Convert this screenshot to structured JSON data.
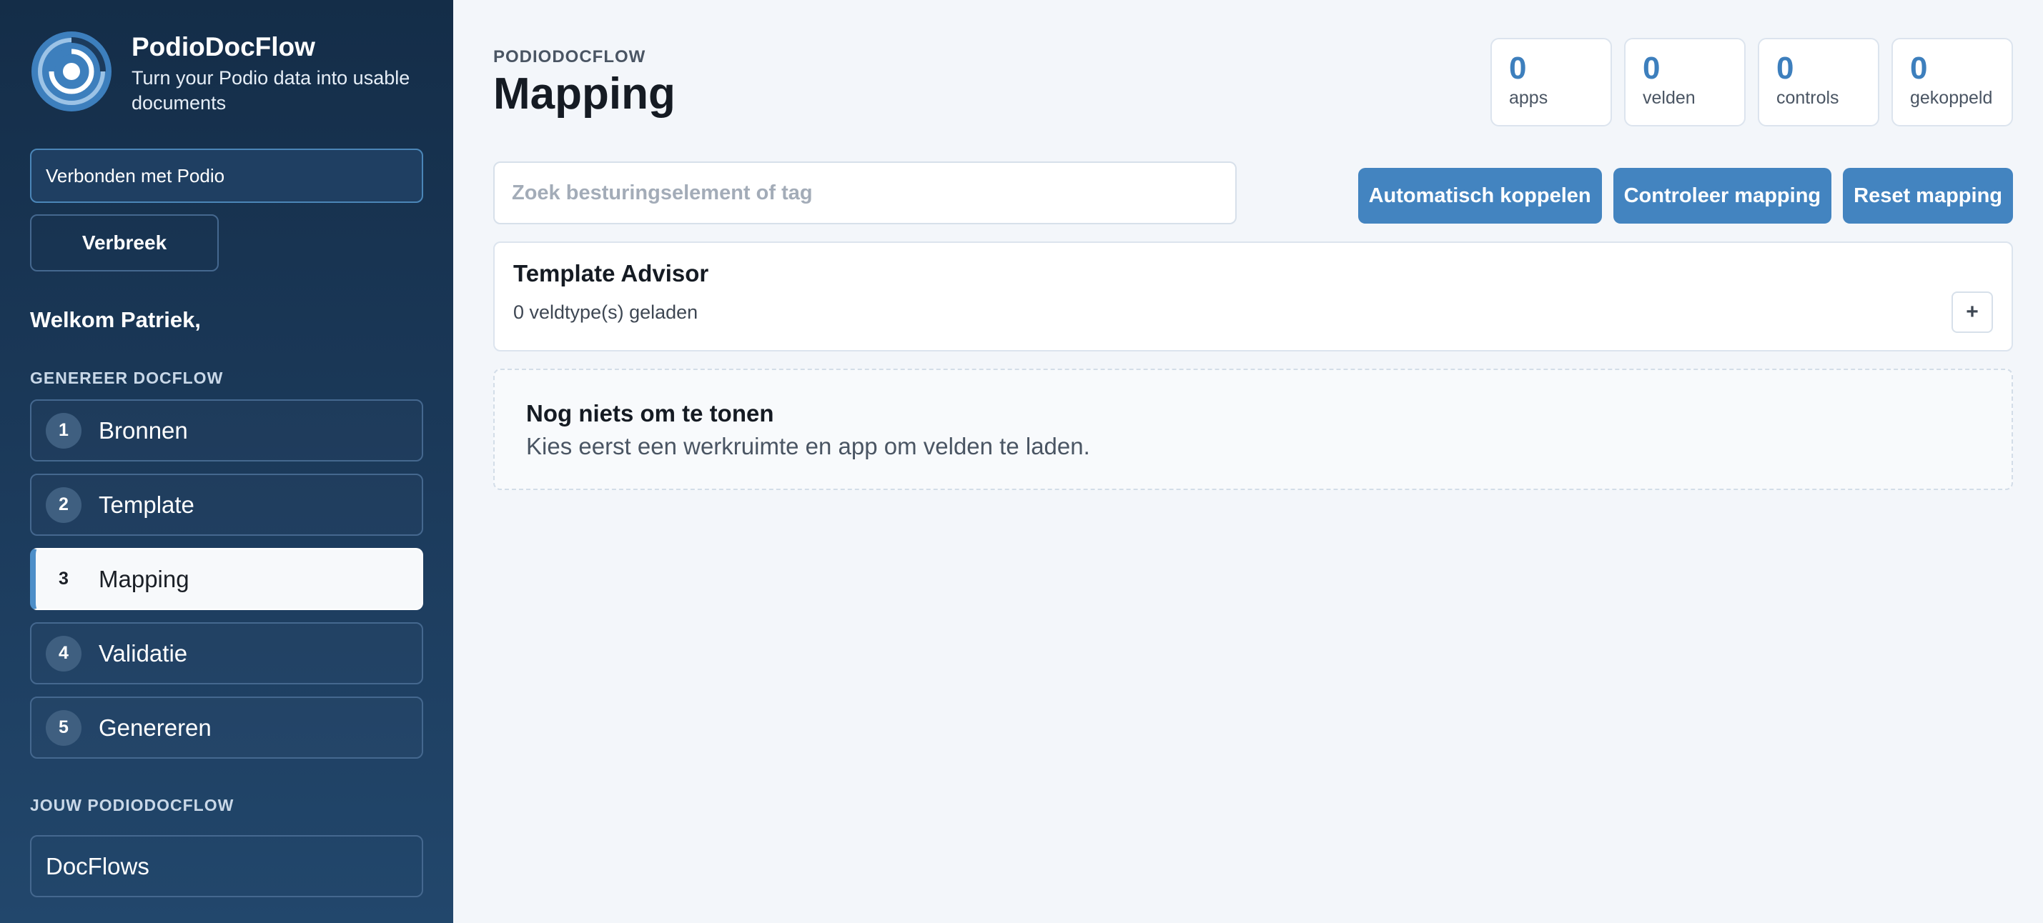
{
  "brand": {
    "title": "PodioDocFlow",
    "subtitle": "Turn your Podio data into usable documents",
    "logo_icon": "podio-ring-logo-icon"
  },
  "sidebar": {
    "connection_status": "Verbonden met Podio",
    "disconnect_label": "Verbreek",
    "welcome": "Welkom Patriek,",
    "generate_section_title": "GENEREER DOCFLOW",
    "steps": [
      {
        "num": "1",
        "label": "Bronnen",
        "active": false
      },
      {
        "num": "2",
        "label": "Template",
        "active": false
      },
      {
        "num": "3",
        "label": "Mapping",
        "active": true
      },
      {
        "num": "4",
        "label": "Validatie",
        "active": false
      },
      {
        "num": "5",
        "label": "Genereren",
        "active": false
      }
    ],
    "yours_section_title": "JOUW PODIODOCFLOW",
    "docflows_label": "DocFlows"
  },
  "header": {
    "eyebrow": "PODIODOCFLOW",
    "title": "Mapping"
  },
  "stats": [
    {
      "value": "0",
      "label": "apps"
    },
    {
      "value": "0",
      "label": "velden"
    },
    {
      "value": "0",
      "label": "controls"
    },
    {
      "value": "0",
      "label": "gekoppeld"
    }
  ],
  "search": {
    "placeholder": "Zoek besturingselement of tag",
    "value": ""
  },
  "actions": {
    "auto_link": "Automatisch koppelen",
    "check": "Controleer mapping",
    "reset": "Reset mapping"
  },
  "advisor": {
    "title": "Template Advisor",
    "subtitle": "0 veldtype(s) geladen",
    "toggle": "+"
  },
  "empty_state": {
    "title": "Nog niets om te tonen",
    "text": "Kies eerst een werkruimte en app om velden te laden."
  },
  "colors": {
    "accent": "#4384c0",
    "stat_value": "#3d7fbd",
    "sidebar_top": "#142d48",
    "sidebar_bottom": "#22476c"
  }
}
